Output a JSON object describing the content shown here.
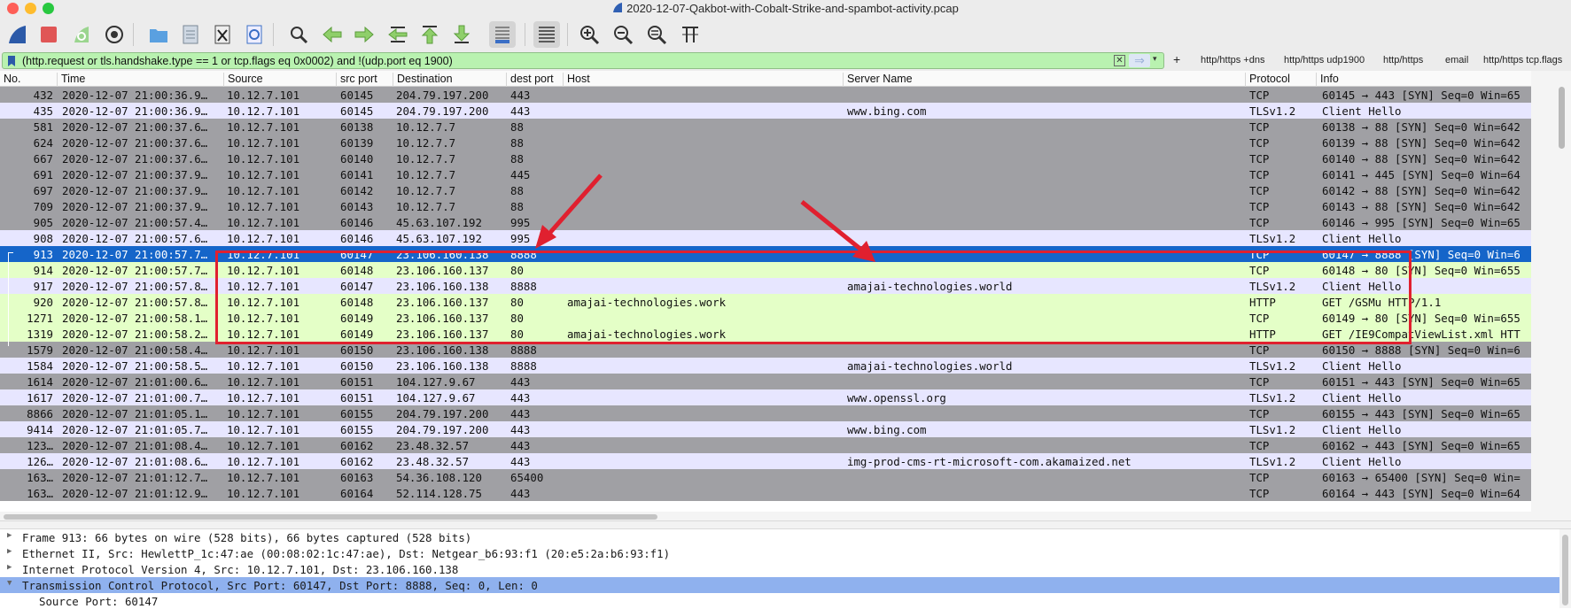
{
  "window": {
    "title": "2020-12-07-Qakbot-with-Cobalt-Strike-and-spambot-activity.pcap"
  },
  "toolbar": {
    "buttons": [
      "shark-fin-icon",
      "stop-icon",
      "restart-icon",
      "capture-options-icon",
      "open-file-icon",
      "file-icon",
      "close-file-icon",
      "reload-icon",
      "find-icon",
      "go-back-icon",
      "go-forward-icon",
      "go-to-packet-icon",
      "first-packet-icon",
      "last-packet-icon",
      "autoscroll-icon",
      "colorize-icon",
      "zoom-in-icon",
      "zoom-out-icon",
      "normal-size-icon",
      "resize-columns-icon"
    ]
  },
  "filter": {
    "text": "(http.request or tls.handshake.type == 1 or tcp.flags eq 0x0002) and !(udp.port eq 1900)",
    "plus": "+",
    "quick_buttons": [
      "http/https +dns",
      "http/https udp1900",
      "http/https",
      "email",
      "http/https tcp.flags"
    ]
  },
  "columns": [
    "No.",
    "Time",
    "Source",
    "src port",
    "Destination",
    "dest port",
    "Host",
    "Server Name",
    "Protocol",
    "Info"
  ],
  "rows": [
    {
      "no": "432",
      "time": "2020-12-07 21:00:36.9…",
      "src": "10.12.7.101",
      "sport": "60145",
      "dst": "204.79.197.200",
      "dport": "443",
      "host": "",
      "sni": "",
      "proto": "TCP",
      "info": "60145 → 443 [SYN] Seq=0 Win=65",
      "color": "gray"
    },
    {
      "no": "435",
      "time": "2020-12-07 21:00:36.9…",
      "src": "10.12.7.101",
      "sport": "60145",
      "dst": "204.79.197.200",
      "dport": "443",
      "host": "",
      "sni": "www.bing.com",
      "proto": "TLSv1.2",
      "info": "Client Hello",
      "color": "lav"
    },
    {
      "no": "581",
      "time": "2020-12-07 21:00:37.6…",
      "src": "10.12.7.101",
      "sport": "60138",
      "dst": "10.12.7.7",
      "dport": "88",
      "host": "",
      "sni": "",
      "proto": "TCP",
      "info": "60138 → 88 [SYN] Seq=0 Win=642",
      "color": "gray"
    },
    {
      "no": "624",
      "time": "2020-12-07 21:00:37.6…",
      "src": "10.12.7.101",
      "sport": "60139",
      "dst": "10.12.7.7",
      "dport": "88",
      "host": "",
      "sni": "",
      "proto": "TCP",
      "info": "60139 → 88 [SYN] Seq=0 Win=642",
      "color": "gray"
    },
    {
      "no": "667",
      "time": "2020-12-07 21:00:37.6…",
      "src": "10.12.7.101",
      "sport": "60140",
      "dst": "10.12.7.7",
      "dport": "88",
      "host": "",
      "sni": "",
      "proto": "TCP",
      "info": "60140 → 88 [SYN] Seq=0 Win=642",
      "color": "gray"
    },
    {
      "no": "691",
      "time": "2020-12-07 21:00:37.9…",
      "src": "10.12.7.101",
      "sport": "60141",
      "dst": "10.12.7.7",
      "dport": "445",
      "host": "",
      "sni": "",
      "proto": "TCP",
      "info": "60141 → 445 [SYN] Seq=0 Win=64",
      "color": "gray"
    },
    {
      "no": "697",
      "time": "2020-12-07 21:00:37.9…",
      "src": "10.12.7.101",
      "sport": "60142",
      "dst": "10.12.7.7",
      "dport": "88",
      "host": "",
      "sni": "",
      "proto": "TCP",
      "info": "60142 → 88 [SYN] Seq=0 Win=642",
      "color": "gray"
    },
    {
      "no": "709",
      "time": "2020-12-07 21:00:37.9…",
      "src": "10.12.7.101",
      "sport": "60143",
      "dst": "10.12.7.7",
      "dport": "88",
      "host": "",
      "sni": "",
      "proto": "TCP",
      "info": "60143 → 88 [SYN] Seq=0 Win=642",
      "color": "gray"
    },
    {
      "no": "905",
      "time": "2020-12-07 21:00:57.4…",
      "src": "10.12.7.101",
      "sport": "60146",
      "dst": "45.63.107.192",
      "dport": "995",
      "host": "",
      "sni": "",
      "proto": "TCP",
      "info": "60146 → 995 [SYN] Seq=0 Win=65",
      "color": "gray"
    },
    {
      "no": "908",
      "time": "2020-12-07 21:00:57.6…",
      "src": "10.12.7.101",
      "sport": "60146",
      "dst": "45.63.107.192",
      "dport": "995",
      "host": "",
      "sni": "",
      "proto": "TLSv1.2",
      "info": "Client Hello",
      "color": "lav"
    },
    {
      "no": "913",
      "time": "2020-12-07 21:00:57.7…",
      "src": "10.12.7.101",
      "sport": "60147",
      "dst": "23.106.160.138",
      "dport": "8888",
      "host": "",
      "sni": "",
      "proto": "TCP",
      "info": "60147 → 8888 [SYN] Seq=0 Win=6",
      "color": "sel"
    },
    {
      "no": "914",
      "time": "2020-12-07 21:00:57.7…",
      "src": "10.12.7.101",
      "sport": "60148",
      "dst": "23.106.160.137",
      "dport": "80",
      "host": "",
      "sni": "",
      "proto": "TCP",
      "info": "60148 → 80 [SYN] Seq=0 Win=655",
      "color": "grn"
    },
    {
      "no": "917",
      "time": "2020-12-07 21:00:57.8…",
      "src": "10.12.7.101",
      "sport": "60147",
      "dst": "23.106.160.138",
      "dport": "8888",
      "host": "",
      "sni": "amajai-technologies.world",
      "proto": "TLSv1.2",
      "info": "Client Hello",
      "color": "lav"
    },
    {
      "no": "920",
      "time": "2020-12-07 21:00:57.8…",
      "src": "10.12.7.101",
      "sport": "60148",
      "dst": "23.106.160.137",
      "dport": "80",
      "host": "amajai-technologies.work",
      "sni": "",
      "proto": "HTTP",
      "info": "GET /GSMu HTTP/1.1",
      "color": "grn"
    },
    {
      "no": "1271",
      "time": "2020-12-07 21:00:58.1…",
      "src": "10.12.7.101",
      "sport": "60149",
      "dst": "23.106.160.137",
      "dport": "80",
      "host": "",
      "sni": "",
      "proto": "TCP",
      "info": "60149 → 80 [SYN] Seq=0 Win=655",
      "color": "grn"
    },
    {
      "no": "1319",
      "time": "2020-12-07 21:00:58.2…",
      "src": "10.12.7.101",
      "sport": "60149",
      "dst": "23.106.160.137",
      "dport": "80",
      "host": "amajai-technologies.work",
      "sni": "",
      "proto": "HTTP",
      "info": "GET /IE9CompatViewList.xml HTT",
      "color": "grn"
    },
    {
      "no": "1579",
      "time": "2020-12-07 21:00:58.4…",
      "src": "10.12.7.101",
      "sport": "60150",
      "dst": "23.106.160.138",
      "dport": "8888",
      "host": "",
      "sni": "",
      "proto": "TCP",
      "info": "60150 → 8888 [SYN] Seq=0 Win=6",
      "color": "gray"
    },
    {
      "no": "1584",
      "time": "2020-12-07 21:00:58.5…",
      "src": "10.12.7.101",
      "sport": "60150",
      "dst": "23.106.160.138",
      "dport": "8888",
      "host": "",
      "sni": "amajai-technologies.world",
      "proto": "TLSv1.2",
      "info": "Client Hello",
      "color": "lav"
    },
    {
      "no": "1614",
      "time": "2020-12-07 21:01:00.6…",
      "src": "10.12.7.101",
      "sport": "60151",
      "dst": "104.127.9.67",
      "dport": "443",
      "host": "",
      "sni": "",
      "proto": "TCP",
      "info": "60151 → 443 [SYN] Seq=0 Win=65",
      "color": "gray"
    },
    {
      "no": "1617",
      "time": "2020-12-07 21:01:00.7…",
      "src": "10.12.7.101",
      "sport": "60151",
      "dst": "104.127.9.67",
      "dport": "443",
      "host": "",
      "sni": "www.openssl.org",
      "proto": "TLSv1.2",
      "info": "Client Hello",
      "color": "lav"
    },
    {
      "no": "8866",
      "time": "2020-12-07 21:01:05.1…",
      "src": "10.12.7.101",
      "sport": "60155",
      "dst": "204.79.197.200",
      "dport": "443",
      "host": "",
      "sni": "",
      "proto": "TCP",
      "info": "60155 → 443 [SYN] Seq=0 Win=65",
      "color": "gray"
    },
    {
      "no": "9414",
      "time": "2020-12-07 21:01:05.7…",
      "src": "10.12.7.101",
      "sport": "60155",
      "dst": "204.79.197.200",
      "dport": "443",
      "host": "",
      "sni": "www.bing.com",
      "proto": "TLSv1.2",
      "info": "Client Hello",
      "color": "lav"
    },
    {
      "no": "123…",
      "time": "2020-12-07 21:01:08.4…",
      "src": "10.12.7.101",
      "sport": "60162",
      "dst": "23.48.32.57",
      "dport": "443",
      "host": "",
      "sni": "",
      "proto": "TCP",
      "info": "60162 → 443 [SYN] Seq=0 Win=65",
      "color": "gray"
    },
    {
      "no": "126…",
      "time": "2020-12-07 21:01:08.6…",
      "src": "10.12.7.101",
      "sport": "60162",
      "dst": "23.48.32.57",
      "dport": "443",
      "host": "",
      "sni": "img-prod-cms-rt-microsoft-com.akamaized.net",
      "proto": "TLSv1.2",
      "info": "Client Hello",
      "color": "lav"
    },
    {
      "no": "163…",
      "time": "2020-12-07 21:01:12.7…",
      "src": "10.12.7.101",
      "sport": "60163",
      "dst": "54.36.108.120",
      "dport": "65400",
      "host": "",
      "sni": "",
      "proto": "TCP",
      "info": "60163 → 65400 [SYN] Seq=0 Win=",
      "color": "gray"
    },
    {
      "no": "163…",
      "time": "2020-12-07 21:01:12.9…",
      "src": "10.12.7.101",
      "sport": "60164",
      "dst": "52.114.128.75",
      "dport": "443",
      "host": "",
      "sni": "",
      "proto": "TCP",
      "info": "60164 → 443 [SYN] Seq=0 Win=64",
      "color": "gray"
    }
  ],
  "details": [
    {
      "text": "Frame 913: 66 bytes on wire (528 bits), 66 bytes captured (528 bits)",
      "expanded": false
    },
    {
      "text": "Ethernet II, Src: HewlettP_1c:47:ae (00:08:02:1c:47:ae), Dst: Netgear_b6:93:f1 (20:e5:2a:b6:93:f1)",
      "expanded": false
    },
    {
      "text": "Internet Protocol Version 4, Src: 10.12.7.101, Dst: 23.106.160.138",
      "expanded": false
    },
    {
      "text": "Transmission Control Protocol, Src Port: 60147, Dst Port: 8888, Seq: 0, Len: 0",
      "expanded": true
    },
    {
      "text": "Source Port: 60147",
      "expanded": null
    }
  ],
  "colors": {
    "row_gray": "#a0a0a4",
    "row_lavender": "#e7e6ff",
    "row_green": "#e4ffc7",
    "row_selected": "#1565c9",
    "detail_selected": "#8fb1ee",
    "annotation": "#e0202f"
  }
}
